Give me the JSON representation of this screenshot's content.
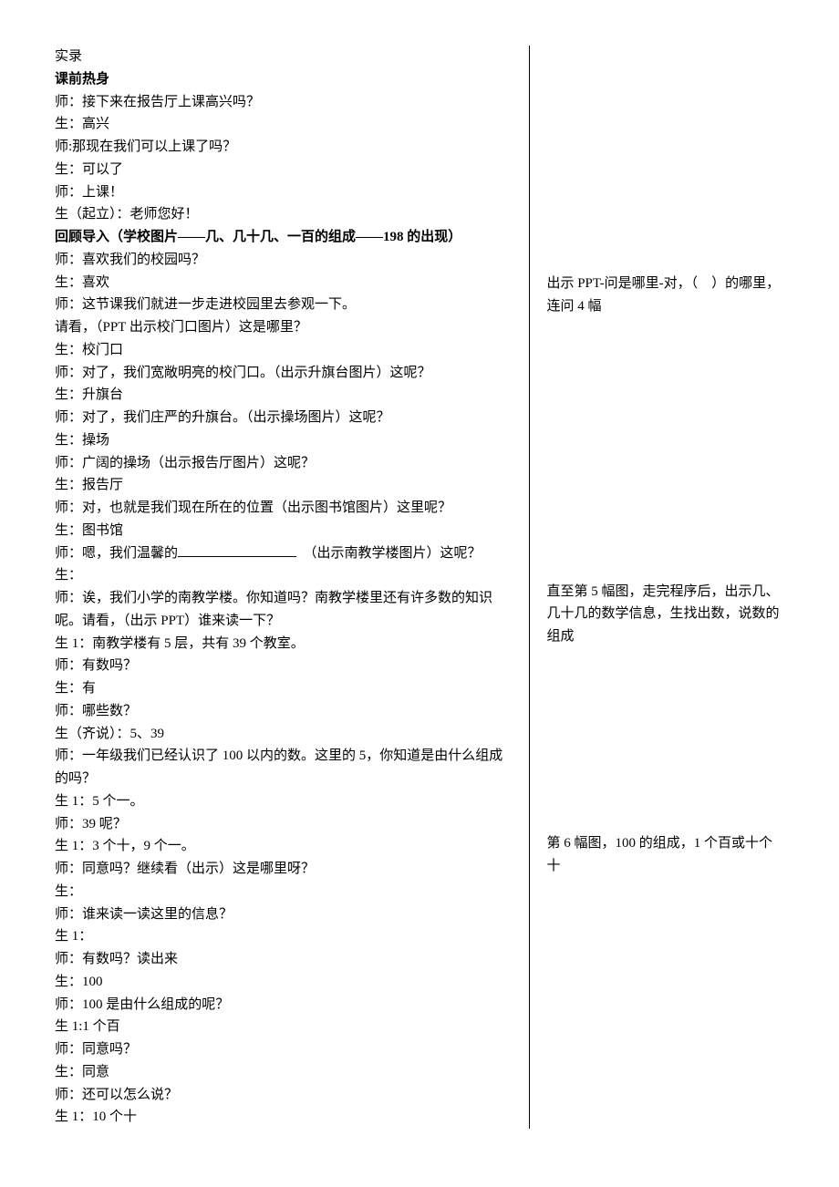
{
  "header": "实录",
  "section1_title": "课前热身",
  "section1": [
    "师：接下来在报告厅上课高兴吗？",
    "生：高兴",
    "师:那现在我们可以上课了吗？",
    "生：可以了",
    "师：上课！",
    "生（起立）：老师您好！"
  ],
  "section2_title": "回顾导入（学校图片——几、几十几、一百的组成——198 的出现）",
  "section2a": [
    "师：喜欢我们的校园吗？",
    "生：喜欢",
    "师：这节课我们就进一步走进校园里去参观一下。",
    "请看，（PPT 出示校门口图片）这是哪里？",
    "生：校门口",
    "师：对了，我们宽敞明亮的校门口。（出示升旗台图片）这呢？",
    "生：升旗台",
    "师：对了，我们庄严的升旗台。（出示操场图片）这呢？",
    "生：操场",
    "师：广阔的操场（出示报告厅图片）这呢？",
    "生：报告厅",
    "师：对，也就是我们现在所在的位置（出示图书馆图片）这里呢？",
    "生：图书馆"
  ],
  "blank_before": "师：嗯，我们温馨的",
  "blank_after": "（出示南教学楼图片）这呢？",
  "section2b": [
    "生：",
    "师：诶，我们小学的南教学楼。你知道吗？南教学楼里还有许多数的知识呢。请看，（出示 PPT）谁来读一下？",
    "生 1：南教学楼有 5 层，共有 39 个教室。",
    "师：有数吗？",
    "生：有",
    "师：哪些数？",
    "生（齐说）：5、39",
    "师：一年级我们已经认识了 100 以内的数。这里的 5，你知道是由什么组成的吗？",
    "生 1：5 个一。",
    "师：39 呢？",
    "生 1：3 个十，9 个一。",
    "师：同意吗？继续看（出示）这是哪里呀？",
    "生：",
    "师：谁来读一读这里的信息？",
    "生 1：",
    "师：有数吗？读出来",
    "生：100",
    "师：100 是由什么组成的呢？",
    "生 1:1 个百",
    "师：同意吗？",
    "生：同意",
    "师：还可以怎么说？",
    "生 1：10 个十"
  ],
  "notes": {
    "n1": "出示 PPT-问是哪里-对，（　）的哪里，连问 4 幅",
    "n2": "直至第 5 幅图，走完程序后，出示几、几十几的数学信息，生找出数，说数的组成",
    "n3": "第 6 幅图，100 的组成，1 个百或十个十"
  }
}
